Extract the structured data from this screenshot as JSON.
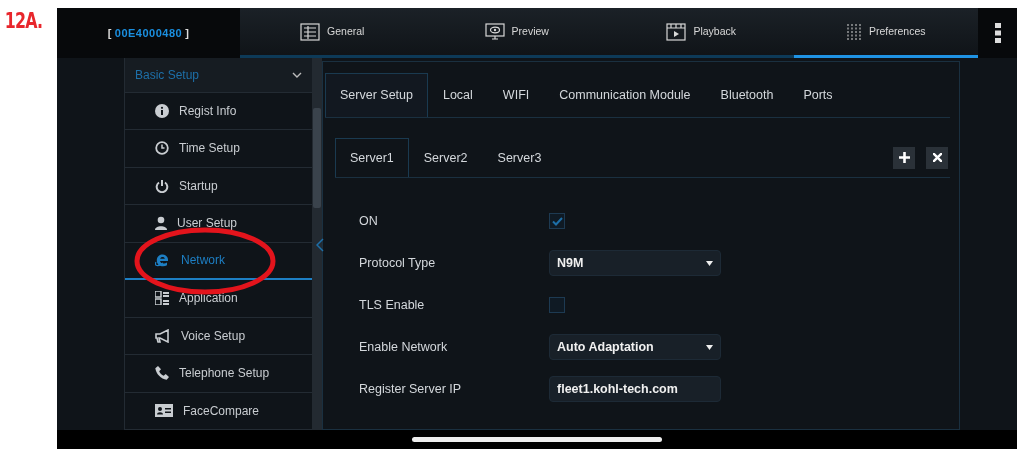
{
  "figure_label": "12A.",
  "header": {
    "bracket_open": "[",
    "device_id": "00E4000480",
    "bracket_close": "]",
    "tabs": [
      {
        "label": "General",
        "selected": false
      },
      {
        "label": "Preview",
        "selected": false
      },
      {
        "label": "Playback",
        "selected": false
      },
      {
        "label": "Preferences",
        "selected": true
      }
    ]
  },
  "sidebar": {
    "section": {
      "title": "Basic Setup",
      "expanded": true
    },
    "items": [
      {
        "label": "Regist Info",
        "selected": false
      },
      {
        "label": "Time Setup",
        "selected": false
      },
      {
        "label": "Startup",
        "selected": false
      },
      {
        "label": "User Setup",
        "selected": false
      },
      {
        "label": "Network",
        "selected": true
      },
      {
        "label": "Application",
        "selected": false
      },
      {
        "label": "Voice Setup",
        "selected": false
      },
      {
        "label": "Telephone Setup",
        "selected": false
      },
      {
        "label": "FaceCompare",
        "selected": false
      }
    ]
  },
  "tabs": [
    {
      "label": "Server Setup",
      "selected": true
    },
    {
      "label": "Local",
      "selected": false
    },
    {
      "label": "WIFI",
      "selected": false
    },
    {
      "label": "Communication Module",
      "selected": false
    },
    {
      "label": "Bluetooth",
      "selected": false
    },
    {
      "label": "Ports",
      "selected": false
    }
  ],
  "server_tabs": [
    {
      "label": "Server1",
      "selected": true
    },
    {
      "label": "Server2",
      "selected": false
    },
    {
      "label": "Server3",
      "selected": false
    }
  ],
  "form": [
    {
      "kind": "checkbox",
      "label": "ON",
      "checked": true
    },
    {
      "kind": "select",
      "label": "Protocol Type",
      "value": "N9M"
    },
    {
      "kind": "checkbox",
      "label": "TLS Enable",
      "checked": false
    },
    {
      "kind": "select",
      "label": "Enable Network",
      "value": "Auto Adaptation"
    },
    {
      "kind": "input",
      "label": "Register Server IP",
      "value": "fleet1.kohl-tech.com"
    }
  ]
}
